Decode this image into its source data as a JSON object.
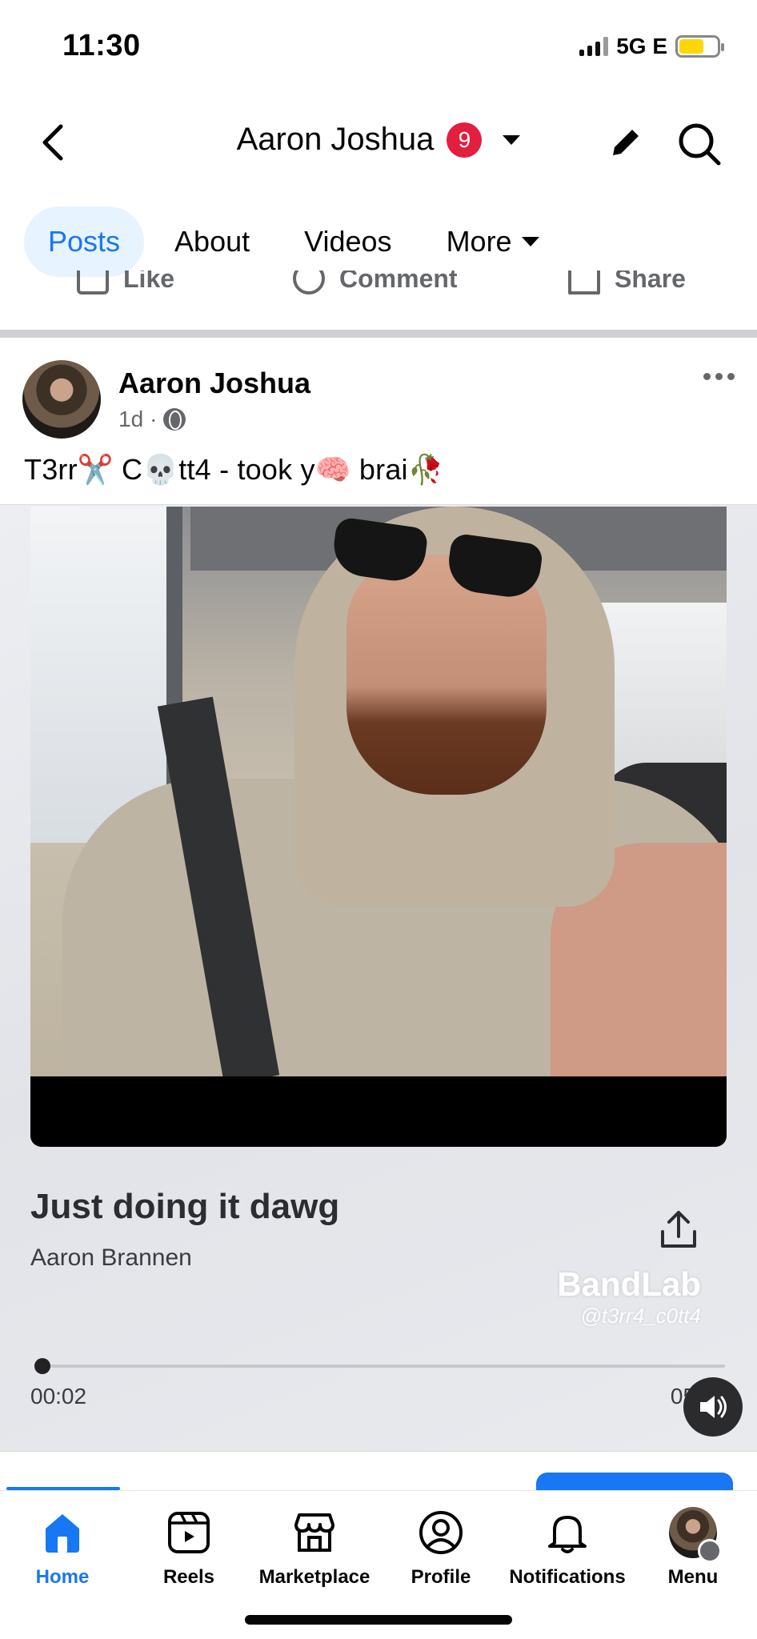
{
  "status_bar": {
    "time": "11:30",
    "network": "5G E"
  },
  "header": {
    "title": "Aaron Joshua",
    "notification_count": "9"
  },
  "tabs": [
    {
      "label": "Posts",
      "active": true
    },
    {
      "label": "About",
      "active": false
    },
    {
      "label": "Videos",
      "active": false
    },
    {
      "label": "More",
      "active": false
    }
  ],
  "previous_post_actions": {
    "like": "Like",
    "comment": "Comment",
    "share": "Share"
  },
  "post": {
    "author": "Aaron Joshua",
    "time": "1d",
    "caption": "T3rr✂️ C💀tt4 - took y🧠 brai🥀",
    "media": {
      "song_title": "Just doing it dawg",
      "artist": "Aaron Brannen",
      "watermark_brand": "BandLab",
      "watermark_handle": "@t3rr4_c0tt4",
      "elapsed": "00:02",
      "total": "05:20",
      "progress_fraction": 0.01
    }
  },
  "bottom_nav": [
    {
      "label": "Home",
      "icon": "home-icon",
      "active": true
    },
    {
      "label": "Reels",
      "icon": "reels-icon",
      "active": false
    },
    {
      "label": "Marketplace",
      "icon": "marketplace-icon",
      "active": false
    },
    {
      "label": "Profile",
      "icon": "profile-icon",
      "active": false
    },
    {
      "label": "Notifications",
      "icon": "bell-icon",
      "active": false
    },
    {
      "label": "Menu",
      "icon": "avatar",
      "active": false
    }
  ],
  "colors": {
    "accent": "#1877f2",
    "badge": "#e41e3f",
    "muted": "#65676b"
  }
}
